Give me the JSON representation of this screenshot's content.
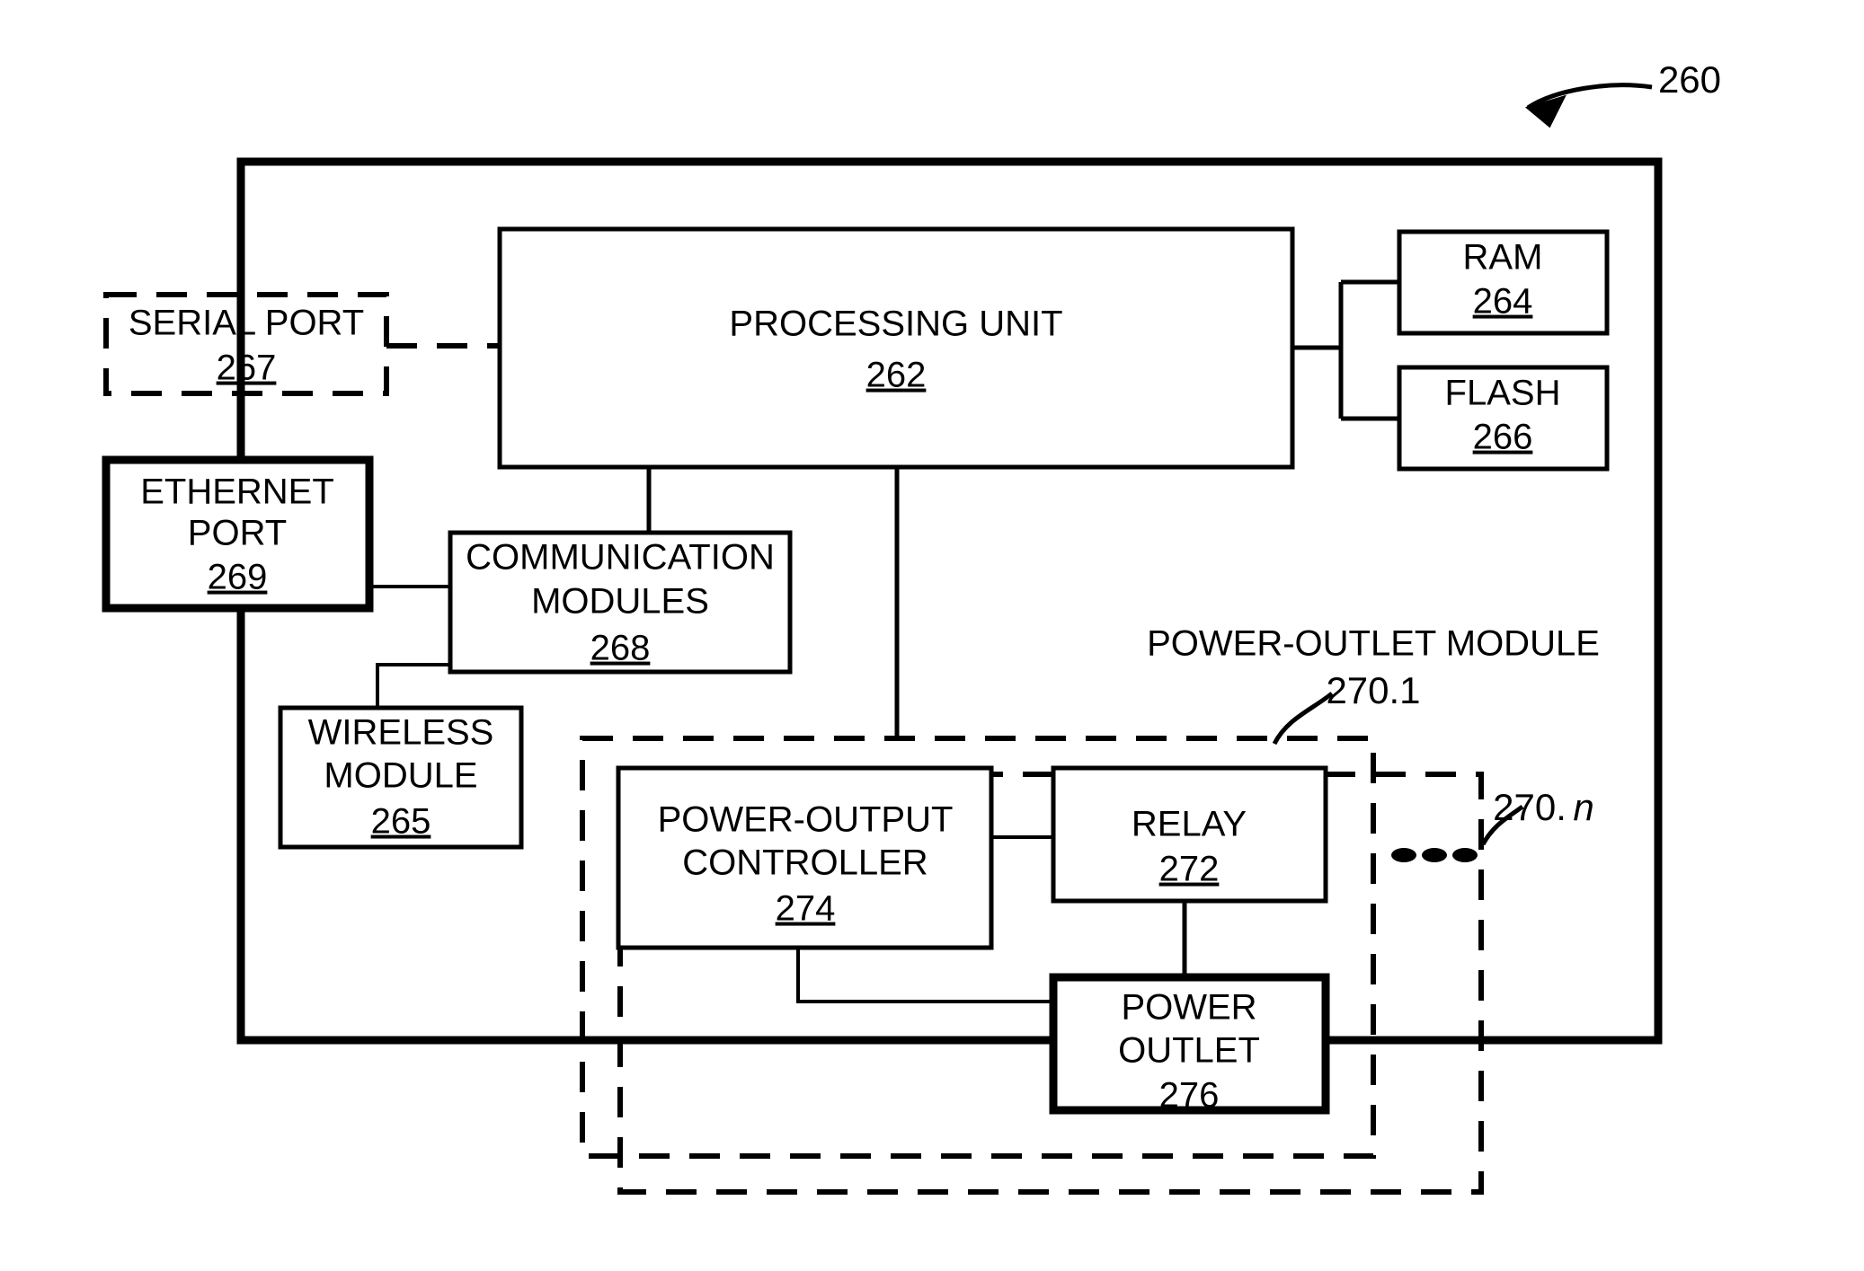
{
  "figure": {
    "reference_numeral": "260",
    "arrow_icon": "curved-arrow-icon"
  },
  "blocks": {
    "serial_port": {
      "line1": "SERIAL PORT",
      "number": "267",
      "border": "dashed"
    },
    "ethernet_port": {
      "line1": "ETHERNET",
      "line2": "PORT",
      "number": "269",
      "border": "thick"
    },
    "processing_unit": {
      "line1": "PROCESSING UNIT",
      "number": "262",
      "border": "solid"
    },
    "ram": {
      "line1": "RAM",
      "number": "264",
      "border": "solid"
    },
    "flash": {
      "line1": "FLASH",
      "number": "266",
      "border": "solid"
    },
    "communication_modules": {
      "line1": "COMMUNICATION",
      "line2": "MODULES",
      "number": "268",
      "border": "solid"
    },
    "wireless_module": {
      "line1": "WIRELESS",
      "line2": "MODULE",
      "number": "265",
      "border": "solid"
    },
    "power_output_controller": {
      "line1": "POWER-OUTPUT",
      "line2": "CONTROLLER",
      "number": "274",
      "border": "solid"
    },
    "relay": {
      "line1": "RELAY",
      "number": "272",
      "border": "solid"
    },
    "power_outlet": {
      "line1": "POWER",
      "line2": "OUTLET",
      "number": "276",
      "border": "thick"
    }
  },
  "annotations": {
    "power_outlet_module_title": "POWER-OUTLET MODULE",
    "power_outlet_module_number": "270.1",
    "additional_module_prefix": "270.",
    "additional_module_suffix": "n",
    "ellipsis": "• • •"
  },
  "colors": {
    "stroke": "#000000",
    "background": "#ffffff"
  }
}
